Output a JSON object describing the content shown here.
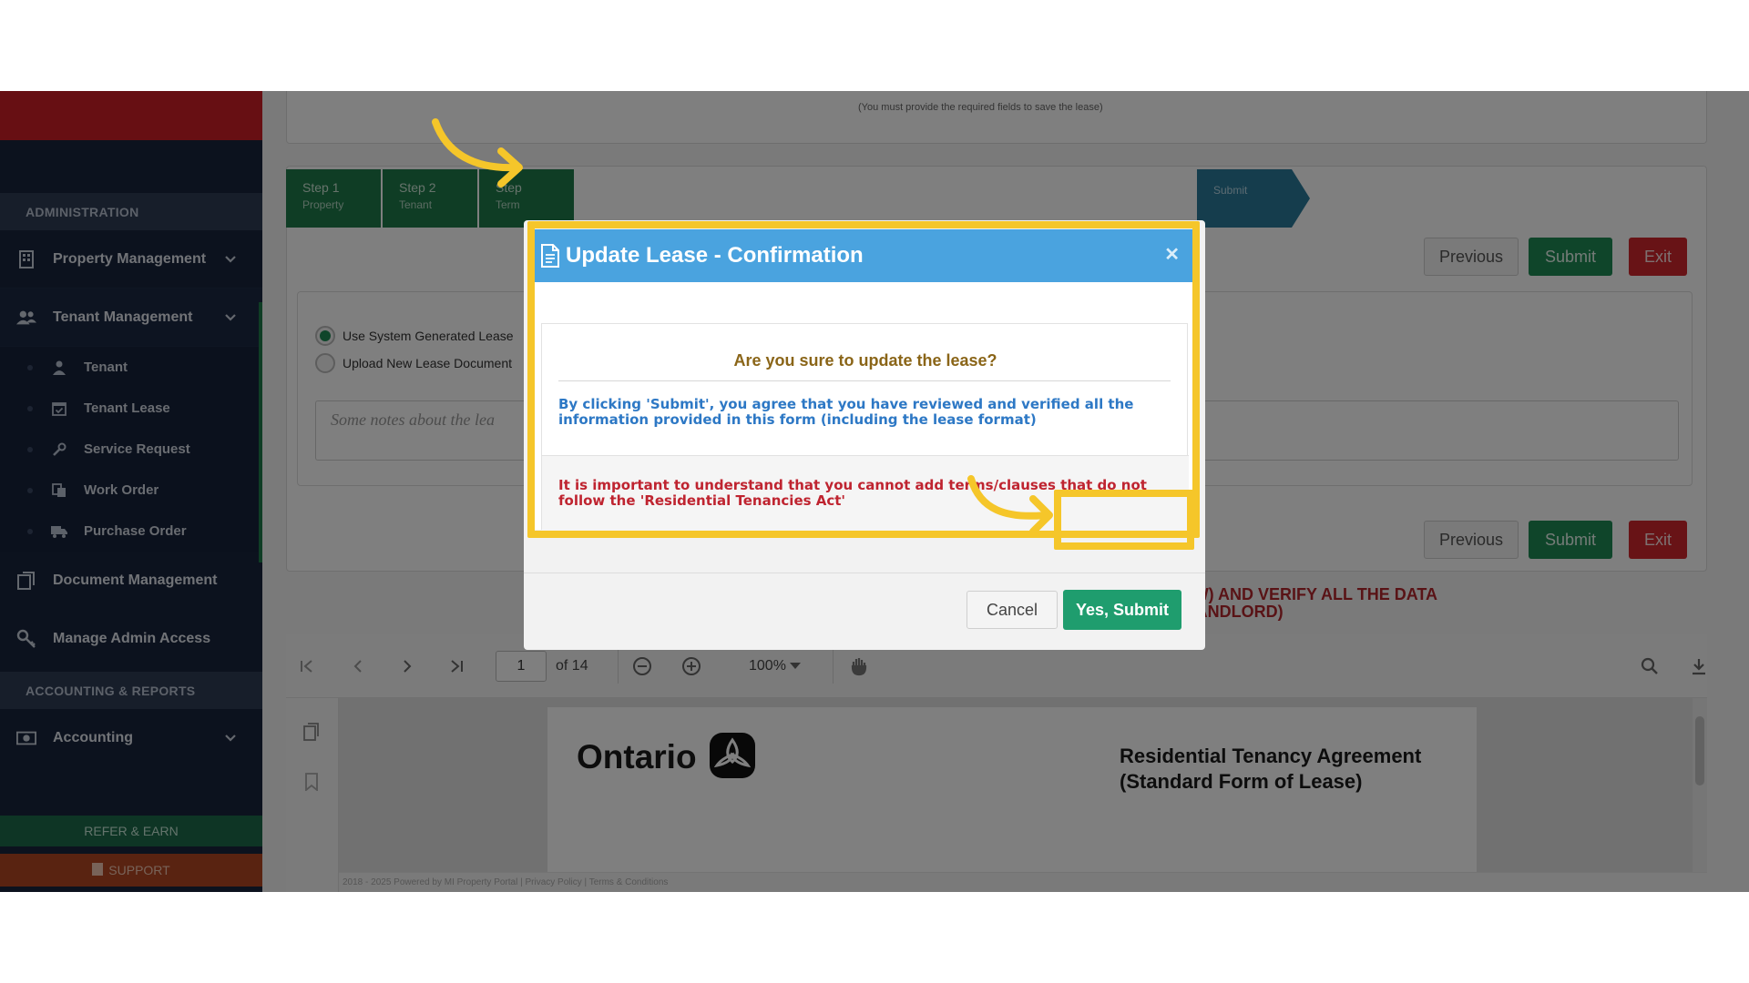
{
  "top_note": "(You must provide the required fields to save the lease)",
  "sidebar": {
    "section_admin": "ADMINISTRATION",
    "items": [
      {
        "label": "Property Management",
        "icon": "building-icon"
      },
      {
        "label": "Tenant Management",
        "icon": "users-icon"
      }
    ],
    "sub_items": [
      {
        "label": "Tenant",
        "icon": "user-icon"
      },
      {
        "label": "Tenant Lease",
        "icon": "calendar-check-icon"
      },
      {
        "label": "Service Request",
        "icon": "wrench-icon"
      },
      {
        "label": "Work Order",
        "icon": "copy-icon"
      },
      {
        "label": "Purchase Order",
        "icon": "truck-icon"
      }
    ],
    "doc_mgmt": "Document Management",
    "admin_access": "Manage Admin Access",
    "section_accounting": "ACCOUNTING & REPORTS",
    "accounting": "Accounting",
    "refer": "REFER & EARN",
    "support": "SUPPORT"
  },
  "steps": [
    {
      "title": "Step 1",
      "sub": "Property"
    },
    {
      "title": "Step 2",
      "sub": "Tenant"
    },
    {
      "title": "Step",
      "sub": "Term"
    },
    {
      "title": "",
      "sub": "Submit"
    }
  ],
  "buttons": {
    "previous": "Previous",
    "submit": "Submit",
    "exit": "Exit"
  },
  "radios": {
    "system": "Use System Generated Lease",
    "upload": "Upload New Lease Document"
  },
  "notes_placeholder": "Some notes about the lea",
  "review": {
    "line1": "PLEASE MAKE SURE TO REVIEW THE LEASE DOCUMENT (PREVIEWED BELOW) AND VERIFY ALL THE DATA",
    "line2": "(THIS MAY SERVE AS LEGAL DOCUMENT FOR A TENANT/LANDLORD)"
  },
  "pdf": {
    "page": "1",
    "of": "of 14",
    "zoom": "100%",
    "ontario": "Ontario",
    "title_line1": "Residential Tenancy Agreement",
    "title_line2": "(Standard Form of Lease)"
  },
  "footer": "2018 - 2025 Powered by MI Property Portal | Privacy Policy | Terms & Conditions",
  "modal": {
    "title": "Update Lease - Confirmation",
    "question": "Are you sure to update the lease?",
    "info": "By clicking 'Submit', you agree that you have reviewed and verified all the information provided in this form (including the lease format)",
    "warning": "It is important to understand that you cannot add terms/clauses that do not follow the 'Residential Tenancies Act'",
    "cancel": "Cancel",
    "yes": "Yes, Submit"
  },
  "colors": {
    "highlight": "#f5c62a",
    "header_blue": "#4aa3df",
    "confirm_green": "#1f9d6e",
    "sidebar_bg": "#18243d"
  }
}
